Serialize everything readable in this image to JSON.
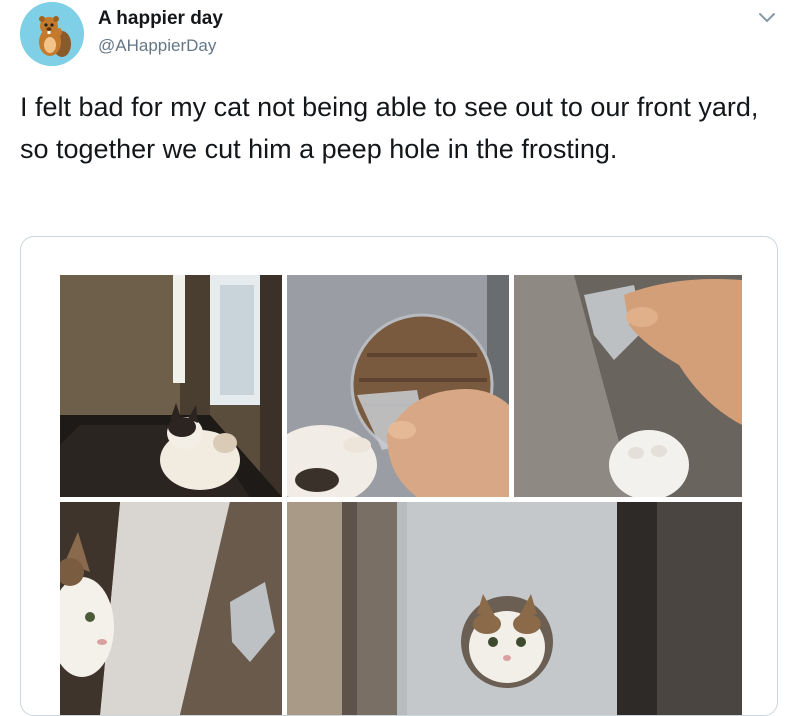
{
  "tweet": {
    "display_name": "A happier day",
    "handle": "@AHappierDay",
    "text": "I felt bad for my cat not being able to see out to our front yard, so together we cut him a peep hole in the frosting."
  },
  "icons": {
    "avatar": "beaver-avatar-icon",
    "menu": "chevron-down-icon"
  },
  "colors": {
    "avatar_bg": "#7fd0e6",
    "handle": "#657786",
    "text": "#14171a",
    "border": "#ccd6dd"
  },
  "media": {
    "photos": [
      {
        "subject": "cat-in-dark-entryway"
      },
      {
        "subject": "hand-peeling-frosting-film"
      },
      {
        "subject": "hand-holding-film-with-cat-paw"
      },
      {
        "subject": "cat-beside-door"
      },
      {
        "subject": "cat-peeking-through-hole"
      }
    ]
  }
}
